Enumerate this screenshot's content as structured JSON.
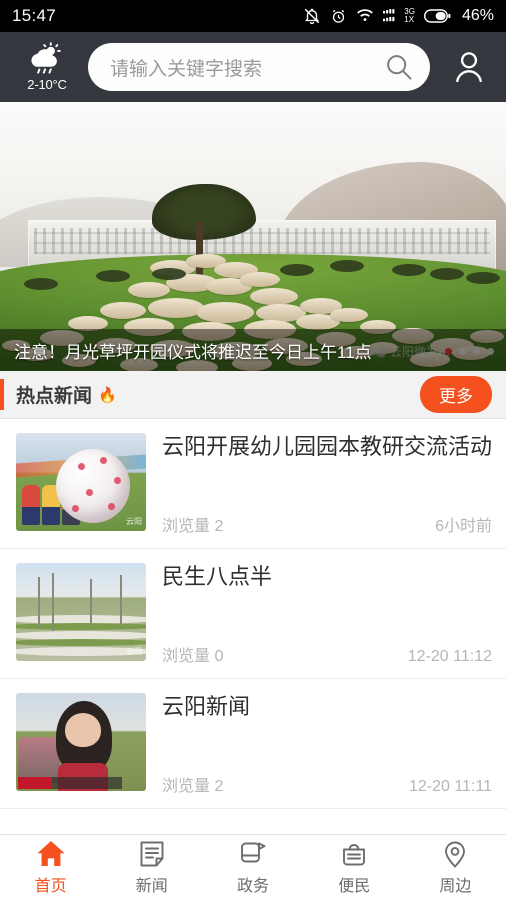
{
  "statusbar": {
    "time": "15:47",
    "network_type": "3G",
    "network_sub": "1X",
    "battery": "46%",
    "icons": [
      "mute-bell-icon",
      "alarm-icon",
      "wifi-icon",
      "signal-icon",
      "battery-icon"
    ]
  },
  "header": {
    "weather_temp": "2-10°C",
    "weather_icon": "sun-cloud-rain-icon",
    "search_placeholder": "请输入关键字搜索",
    "search_value": "",
    "search_icon": "search-icon",
    "profile_icon": "user-icon"
  },
  "banner": {
    "caption": "注意！月光草坪开园仪式将推迟至今日上午11点",
    "watermark": "云阳微发布",
    "dot_count": 4,
    "active_dot": 0
  },
  "section": {
    "title": "热点新闻",
    "flame_icon": "🔥",
    "more_label": "更多",
    "accent_color": "#f4511e"
  },
  "news": [
    {
      "title": "云阳开展幼儿园园本教研交流活动",
      "views": "浏览量 2",
      "time": "6小时前",
      "thumb": "children-bubble-ball-photo"
    },
    {
      "title": "民生八点半",
      "views": "浏览量 0",
      "time": "12-20 11:12",
      "thumb": "terraced-park-photo"
    },
    {
      "title": "云阳新闻",
      "views": "浏览量 2",
      "time": "12-20 11:11",
      "thumb": "interview-woman-photo"
    }
  ],
  "tabbar": [
    {
      "label": "首页",
      "icon": "home-icon",
      "active": true
    },
    {
      "label": "新闻",
      "icon": "news-document-icon",
      "active": false
    },
    {
      "label": "政务",
      "icon": "government-flag-icon",
      "active": false
    },
    {
      "label": "便民",
      "icon": "basket-icon",
      "active": false
    },
    {
      "label": "周边",
      "icon": "location-pin-icon",
      "active": false
    }
  ]
}
